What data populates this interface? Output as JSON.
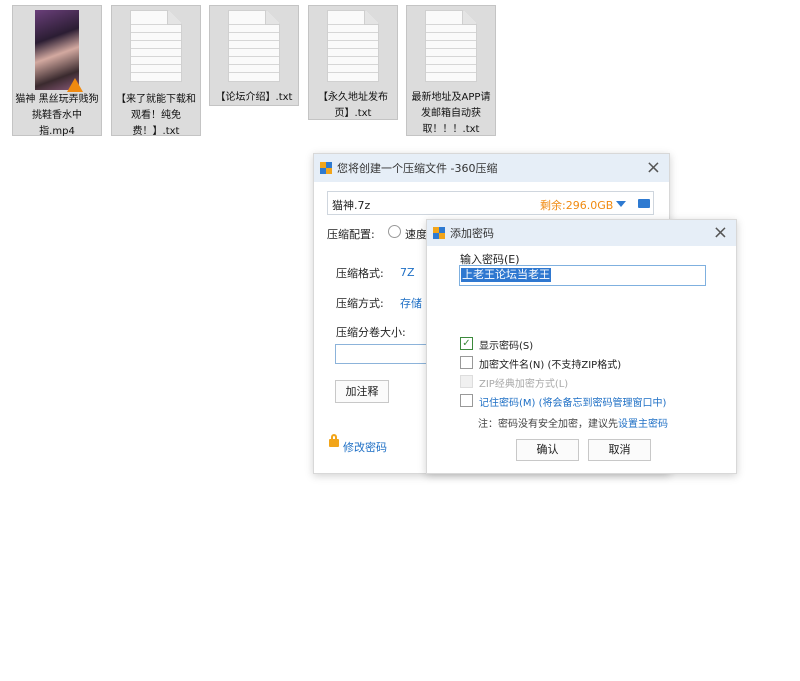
{
  "desktop": {
    "files": [
      {
        "name": "猫神 黑丝玩弄贱狗挑鞋香水中指.mp4",
        "type": "video"
      },
      {
        "name": "【来了就能下载和观看！纯免费！】.txt",
        "type": "text"
      },
      {
        "name": "【论坛介绍】.txt",
        "type": "text"
      },
      {
        "name": "【永久地址发布页】.txt",
        "type": "text"
      },
      {
        "name": "最新地址及APP请发邮箱自动获取！！！.txt",
        "type": "text"
      }
    ]
  },
  "compress_dialog": {
    "title": "您将创建一个压缩文件 -360压缩",
    "filename": "猫神.7z",
    "free_space": "剩余:296.0GB",
    "config_label": "压缩配置:",
    "config_option": "速度",
    "format_label": "压缩格式:",
    "format_value": "7Z",
    "method_label": "压缩方式:",
    "method_value": "存储",
    "split_label": "压缩分卷大小:",
    "split_value": "",
    "comment_button": "加注释",
    "change_password": "修改密码"
  },
  "password_dialog": {
    "title": "添加密码",
    "input_label": "输入密码(E)",
    "password_value": "上老王论坛当老王",
    "options": [
      {
        "label": "显示密码(S)",
        "checked": true,
        "disabled": false
      },
      {
        "label": "加密文件名(N) (不支持ZIP格式)",
        "checked": false,
        "disabled": false
      },
      {
        "label": "ZIP经典加密方式(L)",
        "checked": false,
        "disabled": true
      },
      {
        "label": "记住密码(M) (将会备忘到密码管理窗口中)",
        "checked": false,
        "disabled": false
      }
    ],
    "note_prefix": "注：密码没有安全加密，建议先",
    "note_link": "设置主密码",
    "ok_button": "确认",
    "cancel_button": "取消"
  },
  "colors": {
    "accent": "#1e6fc5",
    "orange": "#f08a10",
    "titlebar": "#e6eef7"
  }
}
